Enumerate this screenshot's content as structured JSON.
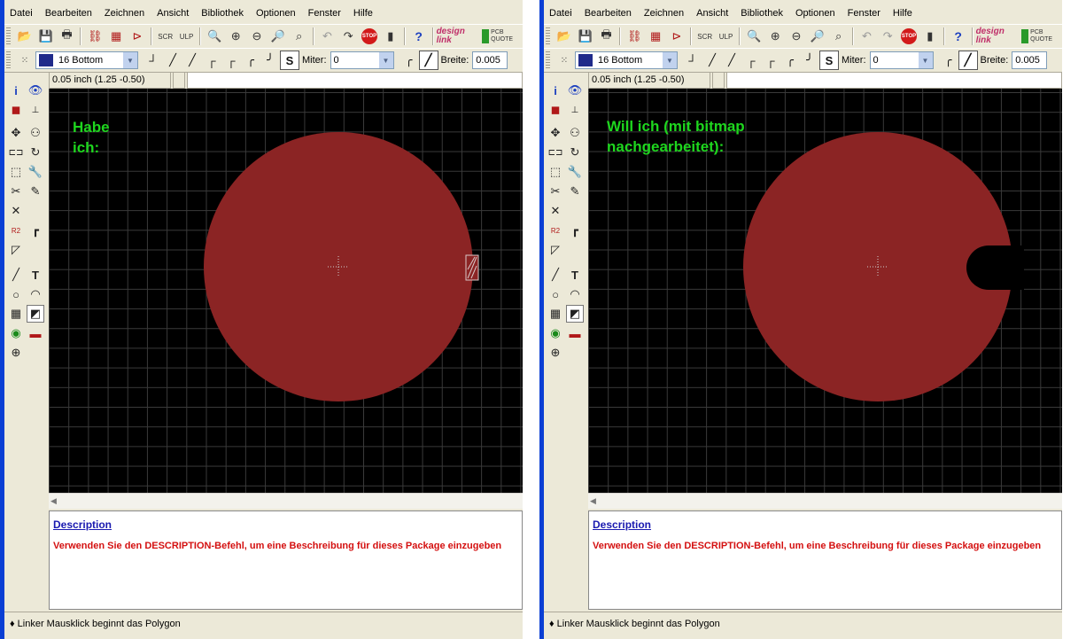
{
  "windows": [
    {
      "id": "left",
      "menu": [
        "Datei",
        "Bearbeiten",
        "Zeichnen",
        "Ansicht",
        "Bibliothek",
        "Optionen",
        "Fenster",
        "Hilfe"
      ],
      "layer": "16 Bottom",
      "miter_label": "Miter:",
      "miter_value": "0",
      "width_label": "Breite:",
      "width_value": "0.005",
      "coordinates": "0.05 inch (1.25 -0.50)",
      "annotation": "Habe\nich:",
      "description_link": "Description",
      "description_text": "Verwenden Sie den DESCRIPTION-Befehl, um eine Beschreibung für dieses Package einzugeben",
      "status": "♦ Linker Mausklick beginnt das Polygon",
      "logo_text": "design link",
      "pcb_quote_text": "PCB QUOTE",
      "stop_text": "STOP",
      "polygon_fill_color": "#8b2424"
    },
    {
      "id": "right",
      "menu": [
        "Datei",
        "Bearbeiten",
        "Zeichnen",
        "Ansicht",
        "Bibliothek",
        "Optionen",
        "Fenster",
        "Hilfe"
      ],
      "layer": "16 Bottom",
      "miter_label": "Miter:",
      "miter_value": "0",
      "width_label": "Breite:",
      "width_value": "0.005",
      "coordinates": "0.05 inch (1.25 -0.50)",
      "annotation": "Will ich (mit bitmap\nnachgearbeitet):",
      "description_link": "Description",
      "description_text": "Verwenden Sie den DESCRIPTION-Befehl, um eine Beschreibung für dieses Package einzugeben",
      "status": "♦ Linker Mausklick beginnt das Polygon",
      "logo_text": "design link",
      "pcb_quote_text": "PCB QUOTE",
      "stop_text": "STOP",
      "polygon_fill_color": "#8b2424"
    }
  ],
  "colors": {
    "canvas_bg": "#000000",
    "grid": "#3a3a3a",
    "annotation": "#1ed61e",
    "description_text": "#d41010",
    "description_link": "#1a1ab0",
    "layer_swatch": "#1f2a8a",
    "window_chrome": "#ece9d8"
  }
}
